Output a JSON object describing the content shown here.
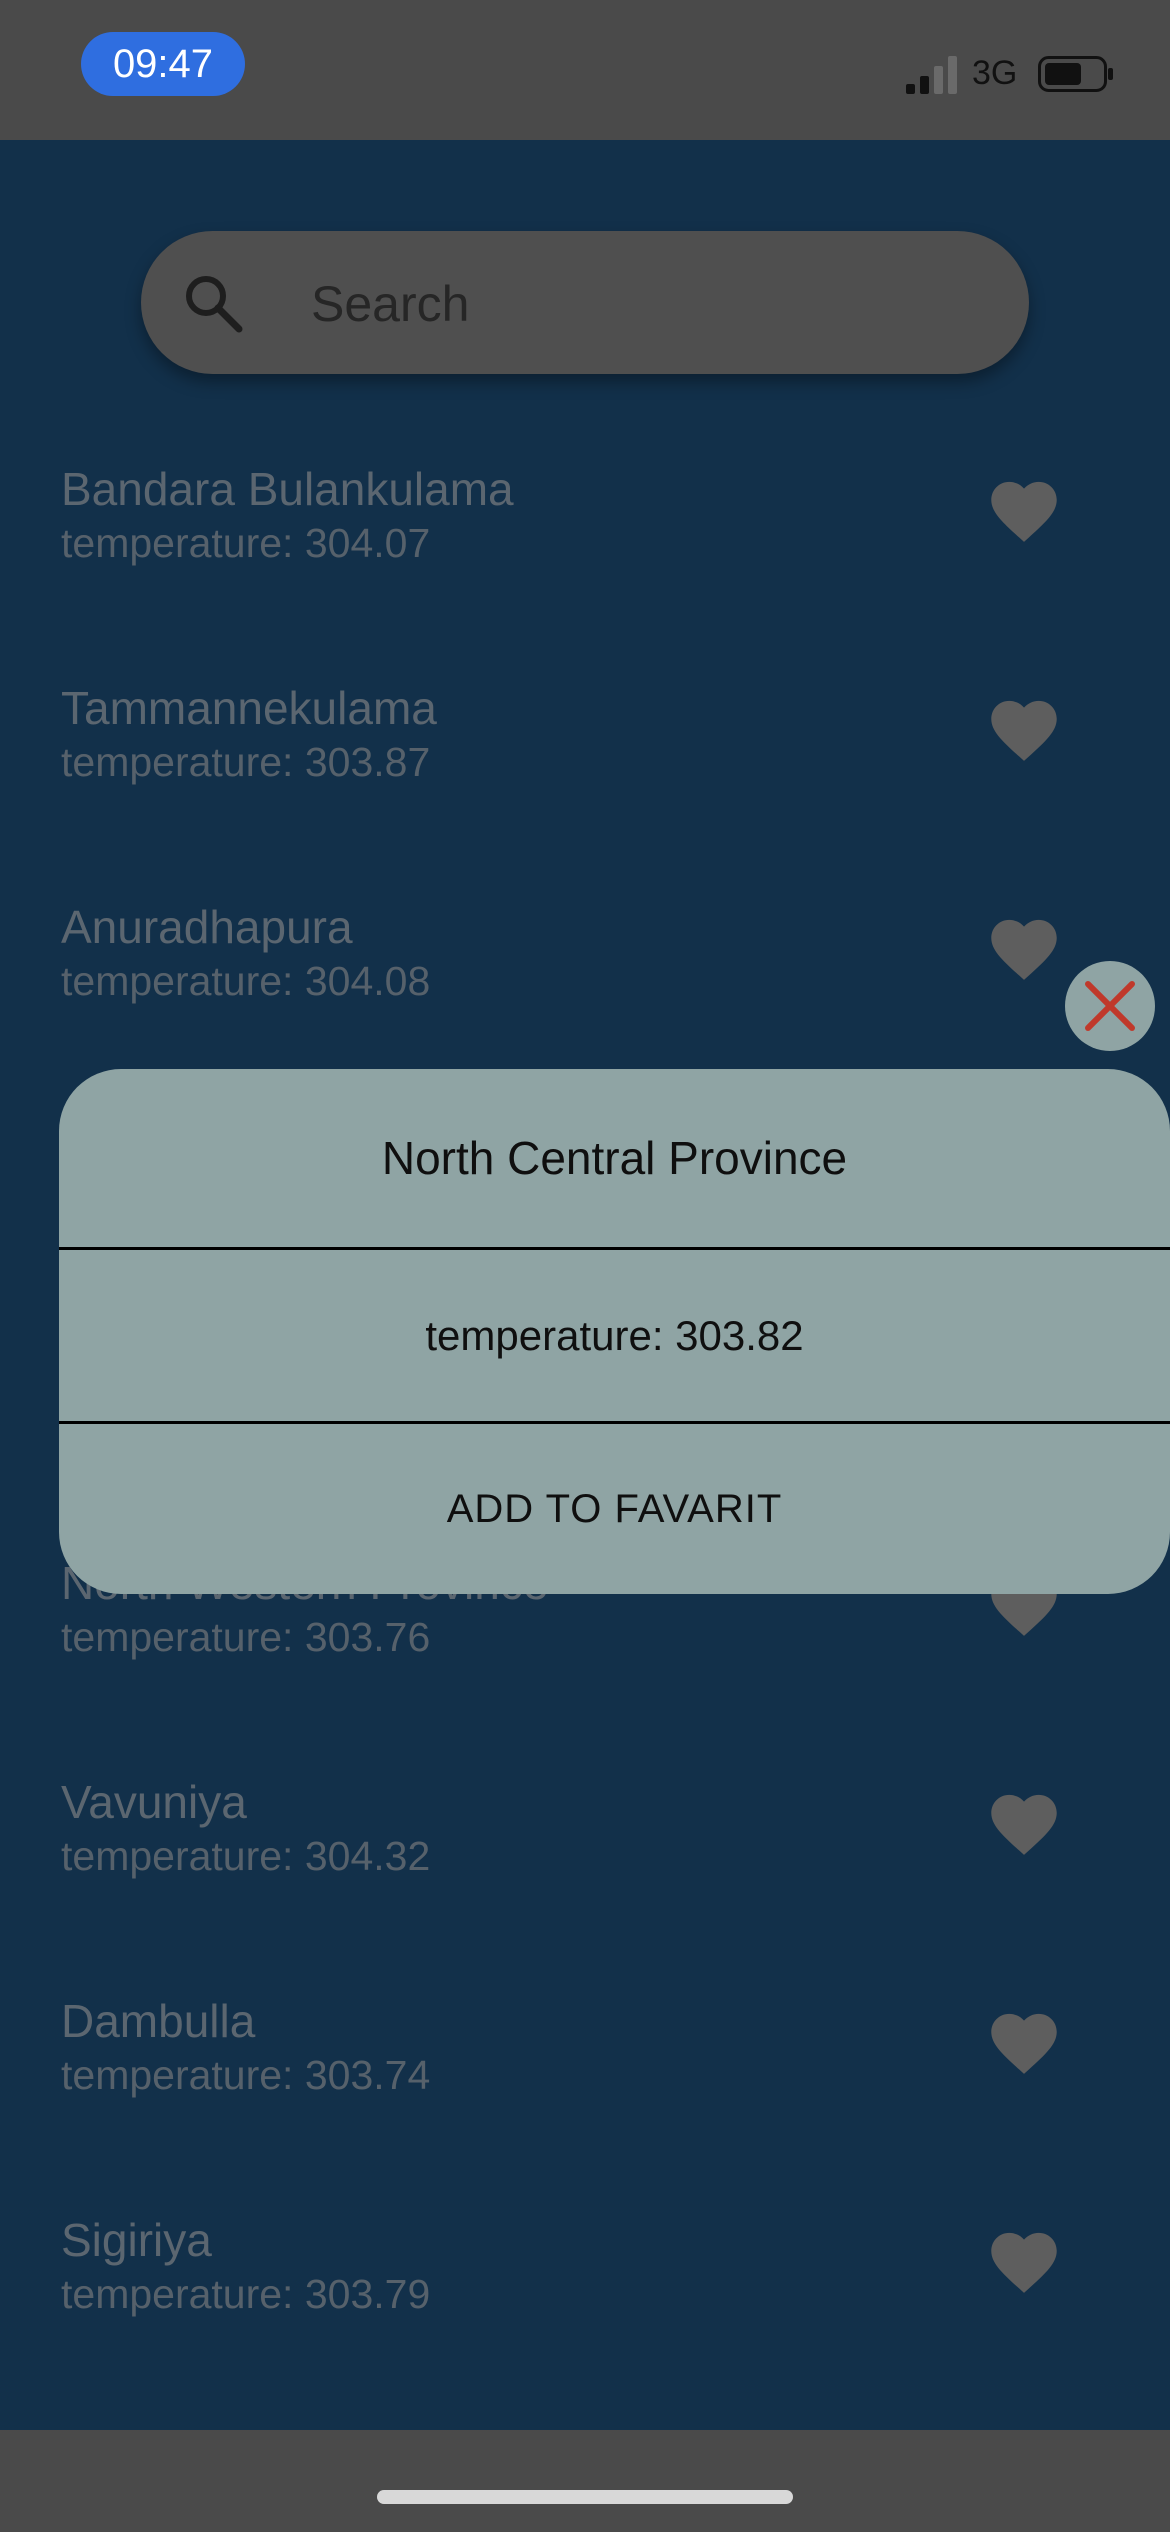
{
  "status_bar": {
    "time": "09:47",
    "network": "3G"
  },
  "search": {
    "placeholder": "Search"
  },
  "list": {
    "items": [
      {
        "name": "Bandara Bulankulama",
        "temperature": "temperature: 304.07"
      },
      {
        "name": "Tammannekulama",
        "temperature": "temperature: 303.87"
      },
      {
        "name": "Anuradhapura",
        "temperature": "temperature: 304.08"
      },
      {
        "name": "North Western Province",
        "temperature": "temperature: 303.76"
      },
      {
        "name": "Vavuniya",
        "temperature": "temperature: 304.32"
      },
      {
        "name": "Dambulla",
        "temperature": "temperature: 303.74"
      },
      {
        "name": "Sigiriya",
        "temperature": "temperature: 303.79"
      }
    ]
  },
  "dialog": {
    "title": "North Central Province",
    "temperature": "temperature: 303.82",
    "add_label": "ADD TO FAVARIT"
  },
  "colors": {
    "background": "#12304a",
    "dialog": "#8fa4a4",
    "close_x": "#c0392b",
    "time_pill": "#2f6ee0"
  },
  "icons": {
    "search": "search-icon",
    "favorite": "heart-icon",
    "close": "close-icon"
  }
}
